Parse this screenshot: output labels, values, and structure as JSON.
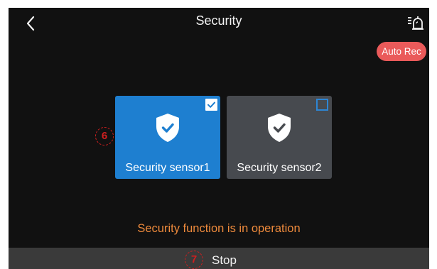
{
  "header": {
    "title": "Security",
    "back_icon": "chevron-left-icon",
    "alarm_icon": "alarm-list-icon"
  },
  "auto_rec": {
    "label": "Auto Rec",
    "color": "#ea5a5a"
  },
  "sensors": [
    {
      "label": "Security sensor1",
      "checked": true,
      "icon": "shield-check-icon",
      "color": "#1e7fd0"
    },
    {
      "label": "Security sensor2",
      "checked": false,
      "icon": "shield-check-icon",
      "color": "#474a4f"
    }
  ],
  "annotations": {
    "sensor_marker": "6",
    "stop_marker": "7",
    "color": "#cf1f1f"
  },
  "status": {
    "text": "Security function is in operation",
    "color": "#ee8a3c"
  },
  "stop_button": {
    "label": "Stop"
  }
}
